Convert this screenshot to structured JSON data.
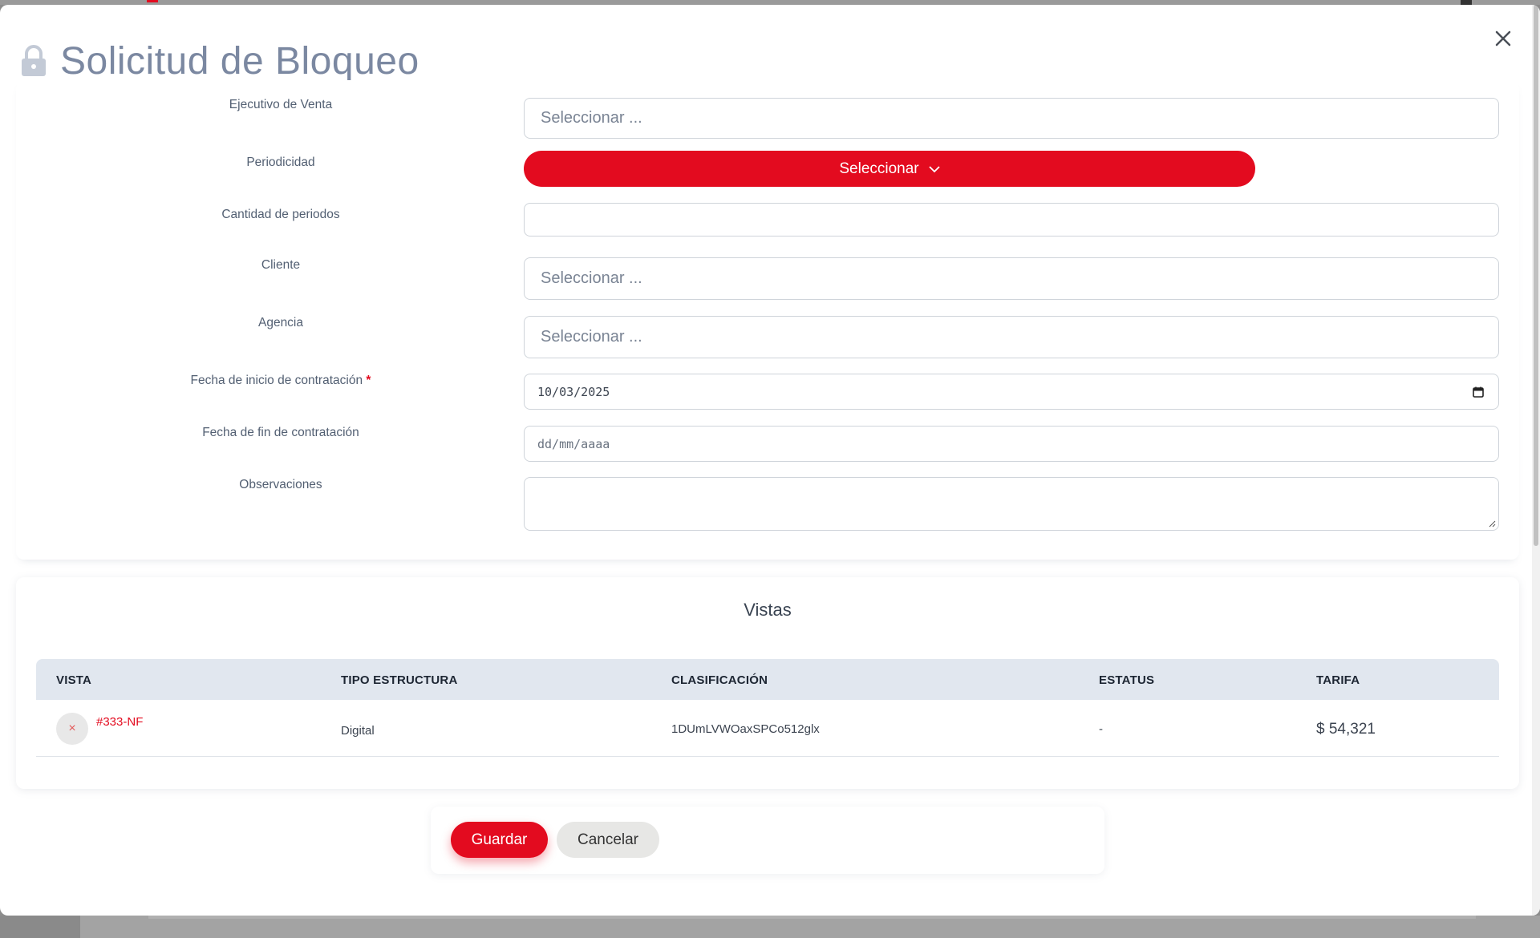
{
  "modal": {
    "title": "Solicitud de Bloqueo",
    "close_label": "×"
  },
  "form": {
    "ejecutivo": {
      "label": "Ejecutivo de Venta",
      "placeholder": "Seleccionar ..."
    },
    "periodicidad": {
      "label": "Periodicidad",
      "button_label": "Seleccionar"
    },
    "cantidad": {
      "label": "Cantidad de periodos",
      "value": ""
    },
    "cliente": {
      "label": "Cliente",
      "placeholder": "Seleccionar ..."
    },
    "agencia": {
      "label": "Agencia",
      "placeholder": "Seleccionar ..."
    },
    "fecha_inicio": {
      "label": "Fecha de inicio de contratación",
      "required_mark": "*",
      "value": "10/03/2025"
    },
    "fecha_fin": {
      "label": "Fecha de fin de contratación",
      "placeholder": "dd/mm/aaaa"
    },
    "observaciones": {
      "label": "Observaciones",
      "value": ""
    }
  },
  "views": {
    "title": "Vistas",
    "columns": [
      "VISTA",
      "TIPO ESTRUCTURA",
      "CLASIFICACIÓN",
      "ESTATUS",
      "TARIFA"
    ],
    "rows": [
      {
        "remove_icon": "×",
        "vista": "#333-NF",
        "tipo": "Digital",
        "clasificacion": "1DUmLVWOaxSPCo512glx",
        "estatus": "-",
        "tarifa": "$ 54,321"
      }
    ]
  },
  "actions": {
    "save_label": "Guardar",
    "cancel_label": "Cancelar"
  },
  "colors": {
    "accent": "#e30b1f",
    "title": "#7b88a1",
    "table_header": "#e1e7ef"
  },
  "icons": {
    "lock": "lock-icon",
    "close": "close-icon",
    "chevron": "chevron-down-icon",
    "calendar": "calendar-icon",
    "remove": "remove-icon"
  }
}
